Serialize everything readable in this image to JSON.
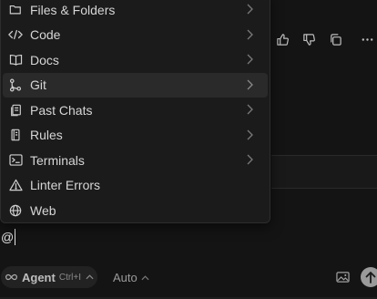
{
  "mention_menu": {
    "items": [
      {
        "label": "Files & Folders",
        "icon": "folder-icon",
        "has_submenu": true
      },
      {
        "label": "Code",
        "icon": "code-icon",
        "has_submenu": true
      },
      {
        "label": "Docs",
        "icon": "book-icon",
        "has_submenu": true
      },
      {
        "label": "Git",
        "icon": "git-branch-icon",
        "has_submenu": true,
        "active": true
      },
      {
        "label": "Past Chats",
        "icon": "chat-history-icon",
        "has_submenu": true
      },
      {
        "label": "Rules",
        "icon": "rules-icon",
        "has_submenu": true
      },
      {
        "label": "Terminals",
        "icon": "terminal-icon",
        "has_submenu": true
      },
      {
        "label": "Linter Errors",
        "icon": "warning-icon",
        "has_submenu": false
      },
      {
        "label": "Web",
        "icon": "globe-icon",
        "has_submenu": false
      }
    ]
  },
  "message_actions": [
    "thumbs-up-icon",
    "thumbs-down-icon",
    "copy-icon",
    "more-icon"
  ],
  "composer": {
    "input_value": "@"
  },
  "toolbar": {
    "mode_label": "Agent",
    "mode_shortcut": "Ctrl+I",
    "model_label": "Auto"
  },
  "colors": {
    "background": "#141414",
    "menu_background": "#1b1b1b",
    "menu_active": "#2a2a2a",
    "text": "#d6d6d6",
    "send_button": "#9a9a9a"
  }
}
